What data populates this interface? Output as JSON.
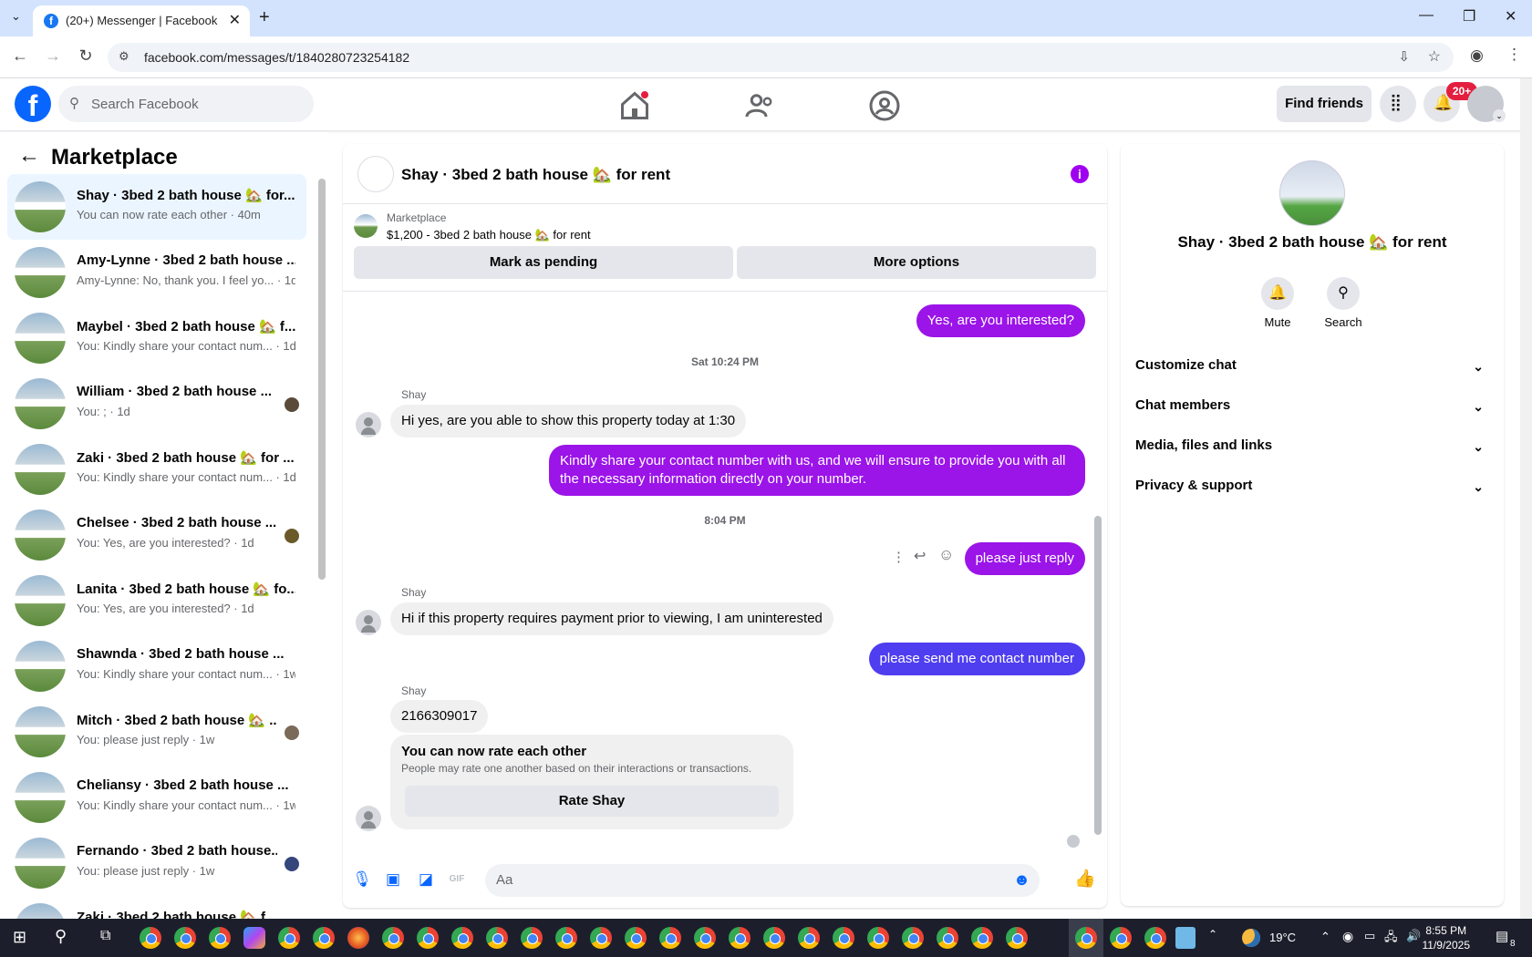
{
  "browser": {
    "tab_title": "(20+) Messenger | Facebook",
    "url": "facebook.com/messages/t/1840280723254182"
  },
  "fb": {
    "search_placeholder": "Search Facebook",
    "find_friends": "Find friends",
    "notif_count": "20+"
  },
  "sidebar": {
    "title": "Marketplace",
    "conversations": [
      {
        "name": "Shay · 3bed 2 bath house 🏡 for...",
        "preview": "You can now rate each other · 40m"
      },
      {
        "name": "Amy-Lynne · 3bed 2 bath house ...",
        "preview": "Amy-Lynne: No, thank you. I feel yo... · 1d"
      },
      {
        "name": "Maybel · 3bed 2 bath house 🏡 f...",
        "preview": "You: Kindly share your contact num... · 1d"
      },
      {
        "name": "William · 3bed 2 bath house ...",
        "preview": "You: ; · 1d"
      },
      {
        "name": "Zaki · 3bed 2 bath house 🏡 for ...",
        "preview": "You: Kindly share your contact num... · 1d"
      },
      {
        "name": "Chelsee · 3bed 2 bath house ...",
        "preview": "You: Yes, are you interested? · 1d"
      },
      {
        "name": "Lanita · 3bed 2 bath house 🏡 fo...",
        "preview": "You: Yes, are you interested? · 1d"
      },
      {
        "name": "Shawnda · 3bed 2 bath house ...",
        "preview": "You: Kindly share your contact num... · 1w"
      },
      {
        "name": "Mitch · 3bed 2 bath house 🏡 ...",
        "preview": "You: please just reply · 1w"
      },
      {
        "name": "Cheliansy · 3bed 2 bath house ...",
        "preview": "You: Kindly share your contact num... · 1w"
      },
      {
        "name": "Fernando · 3bed 2 bath house...",
        "preview": "You: please just reply · 1w"
      },
      {
        "name": "Zaki · 3bed 2 bath house 🏡 f...",
        "preview": ""
      }
    ]
  },
  "chat": {
    "title": "Shay · 3bed 2 bath house 🏡 for rent",
    "listing_source": "Marketplace",
    "listing_text": "$1,200 - 3bed 2 bath house 🏡 for rent",
    "btn_pending": "Mark as pending",
    "btn_more": "More options",
    "msg1": "Yes, are you interested?",
    "stamp1": "Sat 10:24 PM",
    "sender": "Shay",
    "msg2": "Hi yes, are you able to show this property today at 1:30",
    "msg3a": "Kindly share your contact number with us, and we will ensure to provide you with all",
    "msg3b": "the necessary information directly on your number.",
    "stamp2": "8:04 PM",
    "msg4": "please just reply",
    "msg5": "Hi if this property requires payment prior to viewing, I am uninterested",
    "msg6": "please send me contact number",
    "msg7": "2166309017",
    "rate_title": "You can now rate each other",
    "rate_sub": "People may rate one another based on their interactions or transactions.",
    "rate_btn": "Rate Shay",
    "composer_placeholder": "Aa"
  },
  "info": {
    "name": "Shay · 3bed 2 bath house 🏡 for rent",
    "mute": "Mute",
    "search": "Search",
    "rows": [
      "Customize chat",
      "Chat members",
      "Media, files and links",
      "Privacy & support"
    ]
  },
  "taskbar": {
    "temp": "19°C",
    "time": "8:55 PM",
    "date": "11/9/2025",
    "notif": "8"
  }
}
